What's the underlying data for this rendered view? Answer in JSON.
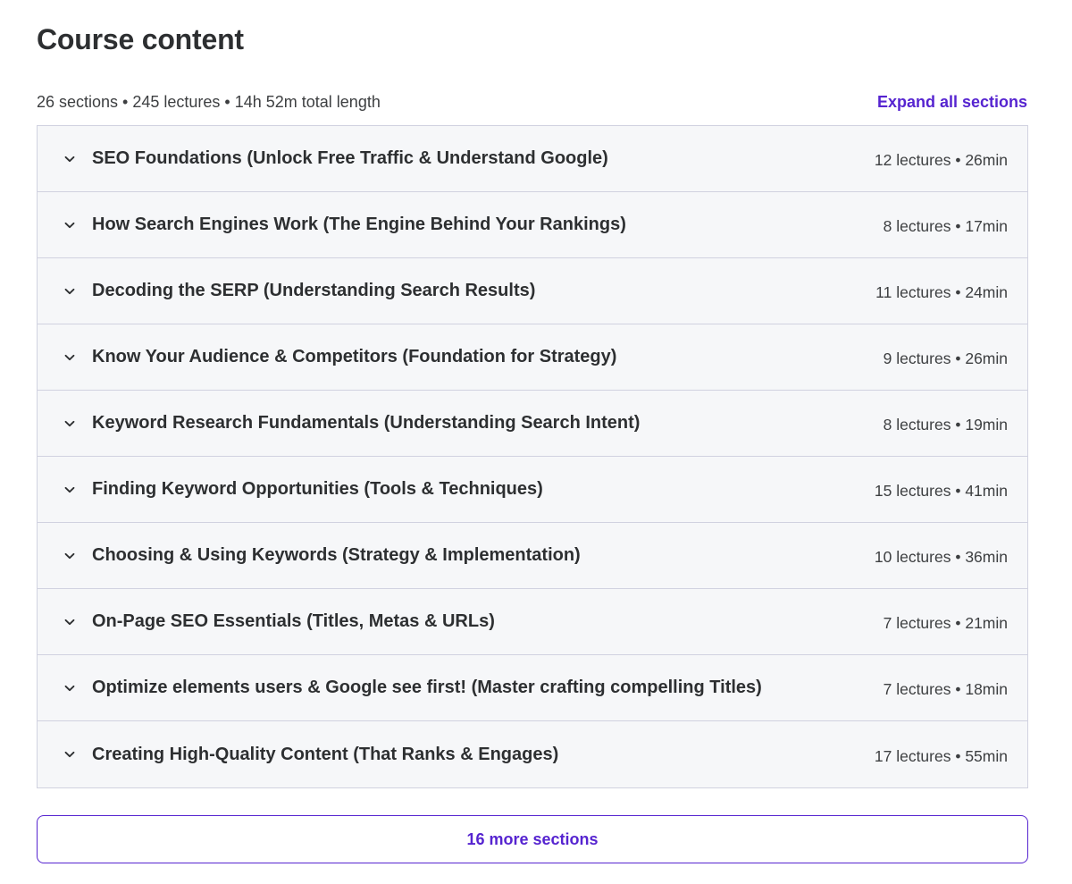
{
  "header": {
    "title": "Course content",
    "summary": "26 sections • 245 lectures • 14h 52m total length",
    "expand_all_label": "Expand all sections"
  },
  "sections": [
    {
      "title": "SEO Foundations (Unlock Free Traffic & Understand Google)",
      "meta": "12 lectures • 26min"
    },
    {
      "title": "How Search Engines Work (The Engine Behind Your Rankings)",
      "meta": "8 lectures • 17min"
    },
    {
      "title": "Decoding the SERP (Understanding Search Results)",
      "meta": "11 lectures • 24min"
    },
    {
      "title": "Know Your Audience & Competitors (Foundation for Strategy)",
      "meta": "9 lectures • 26min"
    },
    {
      "title": "Keyword Research Fundamentals (Understanding Search Intent)",
      "meta": "8 lectures • 19min"
    },
    {
      "title": "Finding Keyword Opportunities (Tools & Techniques)",
      "meta": "15 lectures • 41min"
    },
    {
      "title": "Choosing & Using Keywords (Strategy & Implementation)",
      "meta": "10 lectures • 36min"
    },
    {
      "title": "On-Page SEO Essentials (Titles, Metas & URLs)",
      "meta": "7 lectures • 21min"
    },
    {
      "title": "Optimize elements users & Google see first! (Master crafting compelling Titles)",
      "meta": "7 lectures • 18min"
    },
    {
      "title": "Creating High-Quality Content (That Ranks & Engages)",
      "meta": "17 lectures • 55min"
    }
  ],
  "more_sections_label": "16 more sections",
  "icons": {
    "section_toggle": "chevron-down-icon"
  },
  "colors": {
    "accent": "#5624d0",
    "text": "#2d2f31",
    "row_bg": "#f6f7f9",
    "border": "#d1d2e0"
  }
}
